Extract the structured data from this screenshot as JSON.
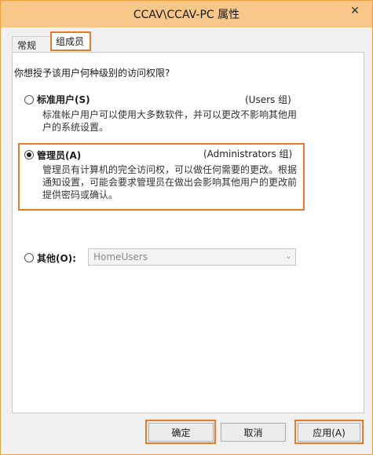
{
  "window": {
    "title": "CCAV\\CCAV-PC 属性",
    "close_label": "✕"
  },
  "tabs": [
    {
      "label": "常规",
      "selected": false
    },
    {
      "label": "组成员",
      "selected": true
    }
  ],
  "question": "你想授予该用户何种级别的访问权限?",
  "options": {
    "standard": {
      "label": "标准用户(S)",
      "group": "(Users 组)",
      "desc_line1": "标准帐户用户可以使用大多数软件，并可以更改不影响其他用",
      "desc_line2": "户的系统设置。",
      "selected": false
    },
    "admin": {
      "label": "管理员(A)",
      "group": "(Administrators 组)",
      "desc_line1": "管理员有计算机的完全访问权，可以做任何需要的更改。根据",
      "desc_line2": "通知设置，可能会要求管理员在做出会影响其他用户的更改前",
      "desc_line3": "提供密码或确认。",
      "selected": true
    },
    "other": {
      "label": "其他(O):",
      "select_value": "HomeUsers",
      "selected": false
    }
  },
  "buttons": {
    "ok": "确定",
    "cancel": "取消",
    "apply": "应用(A)"
  },
  "colors": {
    "highlight": "#e87a2a",
    "titlebar": "#f7c78a"
  }
}
